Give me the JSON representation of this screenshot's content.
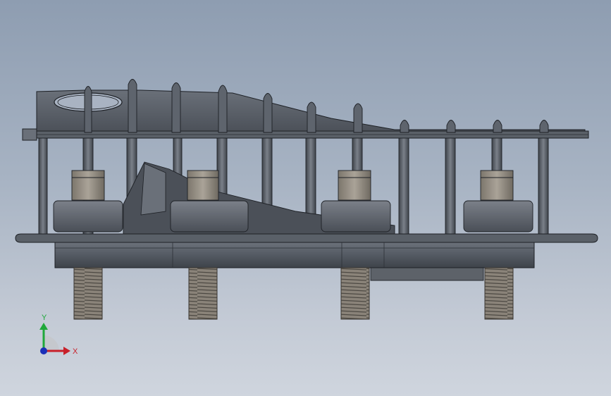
{
  "triad": {
    "x_label": "X",
    "y_label": "Y"
  },
  "colors": {
    "background_top": "#8e9db1",
    "background_bottom": "#cfd5de",
    "model_body": "#5b616b",
    "model_dark": "#3a3f47",
    "model_light": "#7d838c",
    "edge": "#1d2025",
    "screw": "#8c857b",
    "nut": "#a59f93",
    "axis_x": "#c8202a",
    "axis_y": "#1fa83a",
    "axis_z": "#1a2fb8"
  }
}
